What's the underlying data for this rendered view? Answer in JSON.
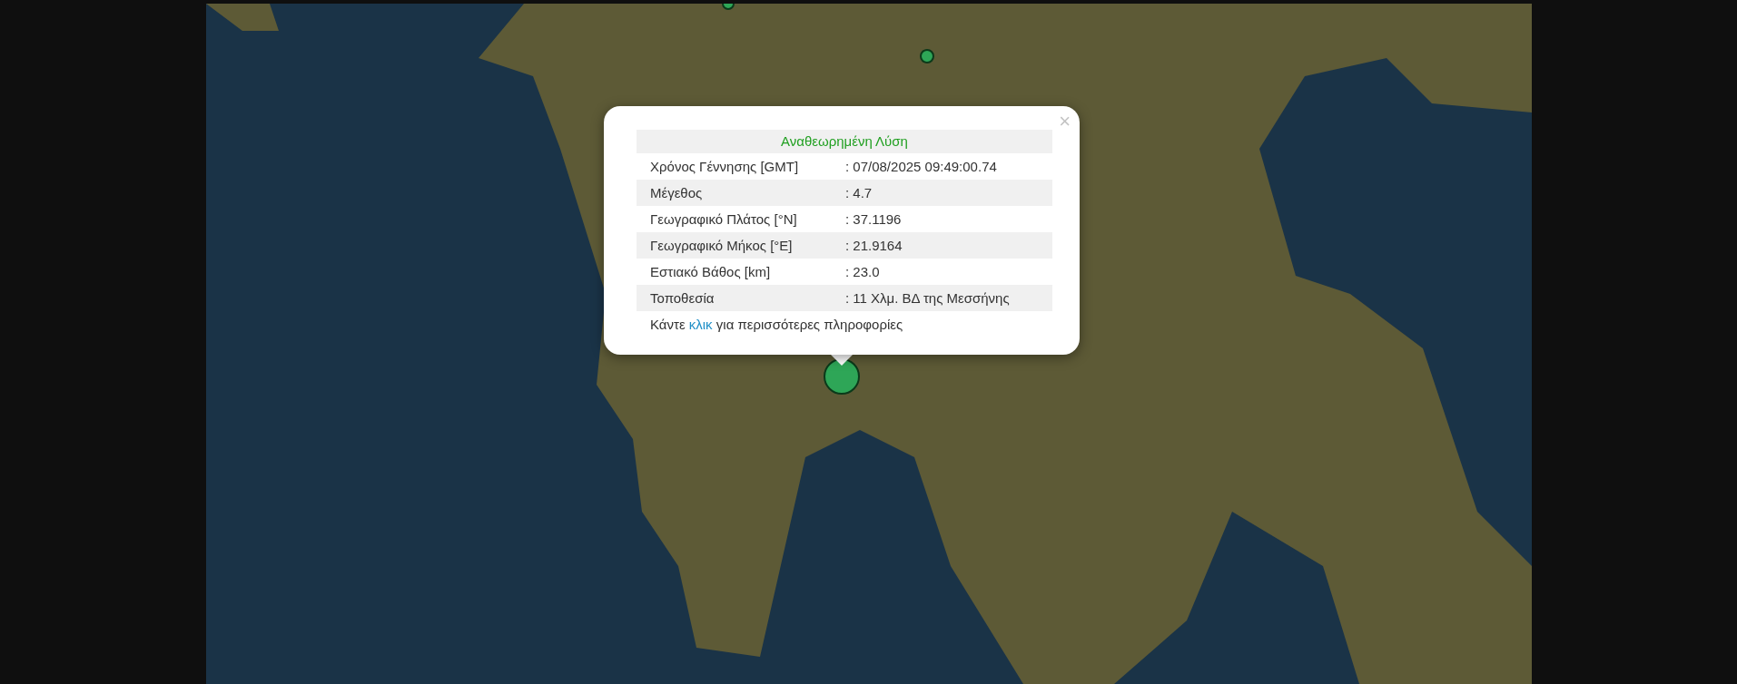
{
  "popup": {
    "close": "×",
    "title": "Αναθεωρημένη Λύση",
    "rows": [
      {
        "label": "Χρόνος Γέννησης [GMT]",
        "value": ": 07/08/2025 09:49:00.74"
      },
      {
        "label": "Μέγεθος",
        "value": ": 4.7"
      },
      {
        "label": "Γεωγραφικό Πλάτος [°N]",
        "value": ": 37.1196"
      },
      {
        "label": "Γεωγραφικό Μήκος [°E]",
        "value": ": 21.9164"
      },
      {
        "label": "Εστιακό Βάθος [km]",
        "value": ": 23.0"
      },
      {
        "label": "Τοποθεσία",
        "value": ": 11 Χλμ. ΒΔ της Μεσσήνης"
      }
    ],
    "footer": {
      "before": "Κάντε",
      "link": "κλικ",
      "after": "για περισσότερες πληροφορίες"
    }
  }
}
